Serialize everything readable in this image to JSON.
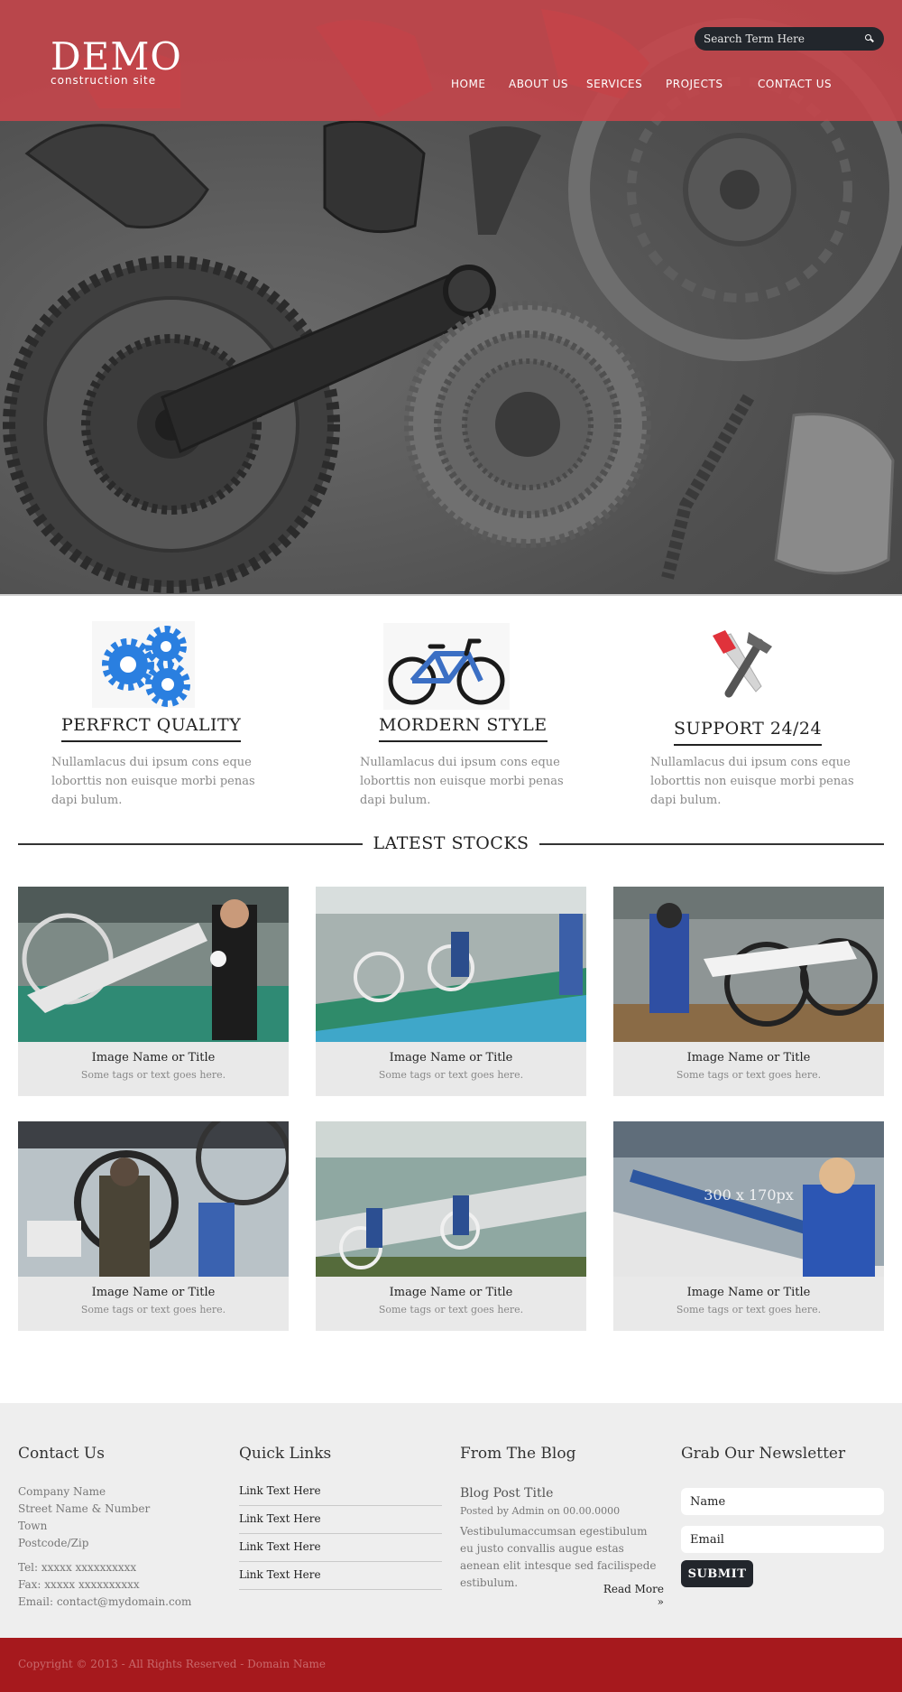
{
  "brand": {
    "title": "DEMO",
    "subtitle": "construction site"
  },
  "search": {
    "placeholder": "Search Term Here"
  },
  "nav": {
    "home": "HOME",
    "about": "ABOUT US",
    "services": "SERVICES",
    "projects": "PROJECTS",
    "contact": "CONTACT US"
  },
  "features": [
    {
      "title": "PERFRCT QUALITY",
      "text": "Nullamlacus dui ipsum cons eque loborttis non euisque morbi penas dapi bulum."
    },
    {
      "title": "MORDERN STYLE",
      "text": "Nullamlacus dui ipsum cons eque loborttis non euisque morbi penas dapi bulum."
    },
    {
      "title": "SUPPORT 24/24",
      "text": "Nullamlacus dui ipsum cons eque loborttis non euisque morbi penas dapi bulum."
    }
  ],
  "stocks": {
    "heading": "LATEST STOCKS",
    "placeholder_text": "300 x 170px",
    "items": [
      {
        "title": "Image Name or Title",
        "tags": "Some tags or text goes here."
      },
      {
        "title": "Image Name or Title",
        "tags": "Some tags or text goes here."
      },
      {
        "title": "Image Name or Title",
        "tags": "Some tags or text goes here."
      },
      {
        "title": "Image Name or Title",
        "tags": "Some tags or text goes here."
      },
      {
        "title": "Image Name or Title",
        "tags": "Some tags or text goes here."
      },
      {
        "title": "Image Name or Title",
        "tags": "Some tags or text goes here."
      }
    ]
  },
  "footer": {
    "contact": {
      "heading": "Contact Us",
      "company": "Company Name",
      "street": "Street Name & Number",
      "town": "Town",
      "postcode": "Postcode/Zip",
      "tel": "Tel: xxxxx xxxxxxxxxx",
      "fax": "Fax: xxxxx xxxxxxxxxx",
      "email": "Email: contact@mydomain.com"
    },
    "quick_links": {
      "heading": "Quick Links",
      "links": [
        "Link Text Here",
        "Link Text Here",
        "Link Text Here",
        "Link Text Here"
      ]
    },
    "blog": {
      "heading": "From The Blog",
      "post_title": "Blog Post Title",
      "meta": "Posted by Admin on 00.00.0000",
      "excerpt": "Vestibulumaccumsan egestibulum eu justo convallis augue estas aenean elit intesque sed facilispede estibulum.",
      "read_more": "Read More »"
    },
    "newsletter": {
      "heading": "Grab Our Newsletter",
      "name_placeholder": "Name",
      "email_placeholder": "Email",
      "submit": "SUBMIT"
    },
    "copyright": "Copyright © 2013 - All Rights Reserved - Domain Name"
  },
  "colors": {
    "topbar": "#c8464b",
    "footer_bar": "#a6191d",
    "dark": "#22262c",
    "card_bg": "#e9e9e9"
  }
}
